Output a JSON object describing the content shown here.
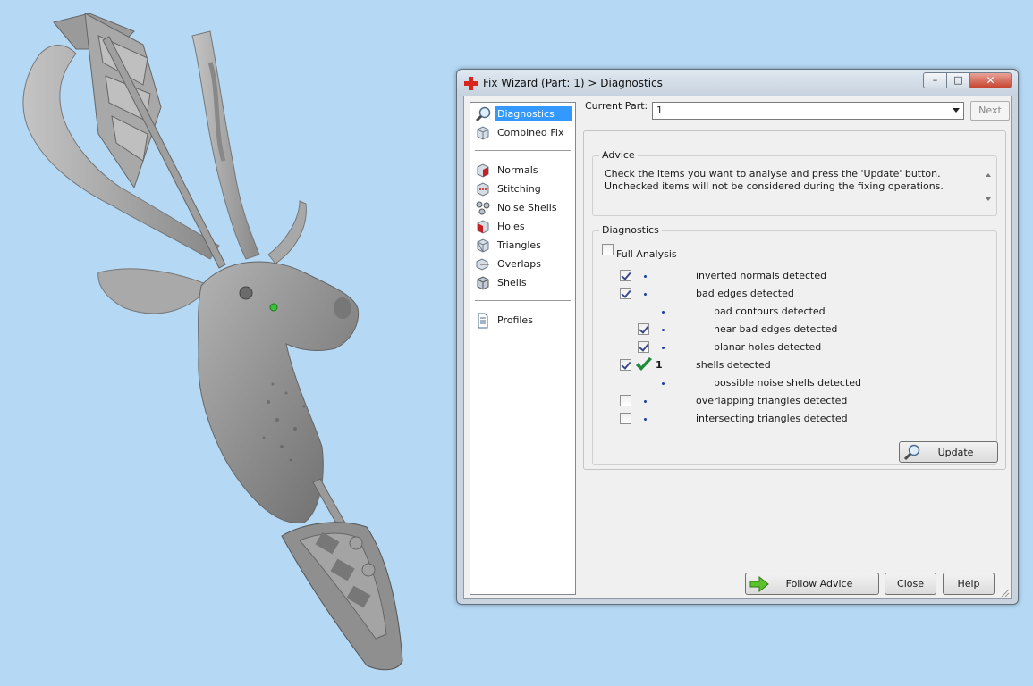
{
  "window": {
    "title": "Fix Wizard (Part: 1) > Diagnostics",
    "minimize": "–",
    "maximize": "□",
    "close": "✕"
  },
  "nav": {
    "items": [
      {
        "label": "Diagnostics",
        "icon": "magnifier-icon",
        "selected": true
      },
      {
        "label": "Combined Fix",
        "icon": "cube-icon"
      },
      {
        "label": "Normals",
        "icon": "normals-cube-icon"
      },
      {
        "label": "Stitching",
        "icon": "stitching-icon"
      },
      {
        "label": "Noise Shells",
        "icon": "noise-shells-icon"
      },
      {
        "label": "Holes",
        "icon": "holes-icon"
      },
      {
        "label": "Triangles",
        "icon": "triangles-icon"
      },
      {
        "label": "Overlaps",
        "icon": "overlaps-icon"
      },
      {
        "label": "Shells",
        "icon": "shells-icon"
      },
      {
        "label": "Profiles",
        "icon": "document-icon"
      }
    ]
  },
  "header": {
    "current_part_label": "Current Part:",
    "current_part_value": "1",
    "next_label": "Next"
  },
  "advice": {
    "title": "Advice",
    "text": "Check the items you want to analyse and press the 'Update' button. Unchecked items will not be considered during the fixing operations."
  },
  "diagnostics": {
    "title": "Diagnostics",
    "full_analysis_label": "Full Analysis",
    "full_analysis_checked": false,
    "rows": [
      {
        "label": "inverted normals detected",
        "checked": true,
        "count": ""
      },
      {
        "label": "bad edges detected",
        "checked": true,
        "count": ""
      },
      {
        "label": "bad contours detected",
        "count": ""
      },
      {
        "label": "near bad edges detected",
        "checked": true,
        "count": ""
      },
      {
        "label": "planar holes detected",
        "checked": true,
        "count": ""
      },
      {
        "label": "shells detected",
        "checked": true,
        "count": "1",
        "status": "ok"
      },
      {
        "label": "possible noise shells detected",
        "count": ""
      },
      {
        "label": "overlapping triangles detected",
        "checked": false,
        "count": ""
      },
      {
        "label": "intersecting triangles detected",
        "checked": false,
        "count": ""
      }
    ],
    "update_label": "Update"
  },
  "buttons": {
    "follow_advice": "Follow Advice",
    "close": "Close",
    "help": "Help"
  },
  "colors": {
    "background": "#b5d9f4",
    "selection": "#3399ff",
    "model_grey": "#8f8f8f",
    "ok_green": "#1e8a3a"
  }
}
